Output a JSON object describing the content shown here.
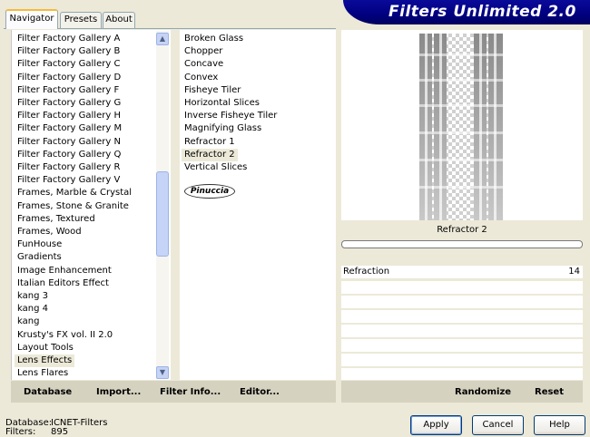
{
  "tabs": [
    {
      "label": "Navigator",
      "active": true
    },
    {
      "label": "Presets",
      "active": false
    },
    {
      "label": "About",
      "active": false
    }
  ],
  "banner_title": "Filters Unlimited 2.0",
  "categories": [
    "Filter Factory Gallery A",
    "Filter Factory Gallery B",
    "Filter Factory Gallery C",
    "Filter Factory Gallery D",
    "Filter Factory Gallery F",
    "Filter Factory Gallery G",
    "Filter Factory Gallery H",
    "Filter Factory Gallery M",
    "Filter Factory Gallery N",
    "Filter Factory Gallery Q",
    "Filter Factory Gallery R",
    "Filter Factory Gallery V",
    "Frames, Marble & Crystal",
    "Frames, Stone & Granite",
    "Frames, Textured",
    "Frames, Wood",
    "FunHouse",
    "Gradients",
    "Image Enhancement",
    "Italian Editors Effect",
    "kang 3",
    "kang 4",
    "kang",
    "Krusty's FX vol. II 2.0",
    "Layout Tools",
    "Lens Effects",
    "Lens Flares"
  ],
  "selected_category": "Lens Effects",
  "filters": [
    "Broken Glass",
    "Chopper",
    "Concave",
    "Convex",
    "Fisheye Tiler",
    "Horizontal Slices",
    "Inverse Fisheye Tiler",
    "Magnifying Glass",
    "Refractor 1",
    "Refractor 2",
    "Vertical Slices"
  ],
  "selected_filter": "Refractor 2",
  "author_badge": "Pinuccia",
  "preview_filter_name": "Refractor 2",
  "parameters": [
    {
      "label": "Refraction",
      "value": "14"
    }
  ],
  "toolbar": {
    "database": "Database",
    "import": "Import...",
    "filter_info": "Filter Info...",
    "editor": "Editor...",
    "randomize": "Randomize",
    "reset": "Reset"
  },
  "status": {
    "database_label": "Database:",
    "database_value": "ICNET-Filters",
    "filters_label": "Filters:",
    "filters_value": "895"
  },
  "buttons": {
    "apply": "Apply",
    "cancel": "Cancel",
    "help": "Help"
  },
  "colors": {
    "banner": "#000080",
    "background": "#ece9d8"
  }
}
